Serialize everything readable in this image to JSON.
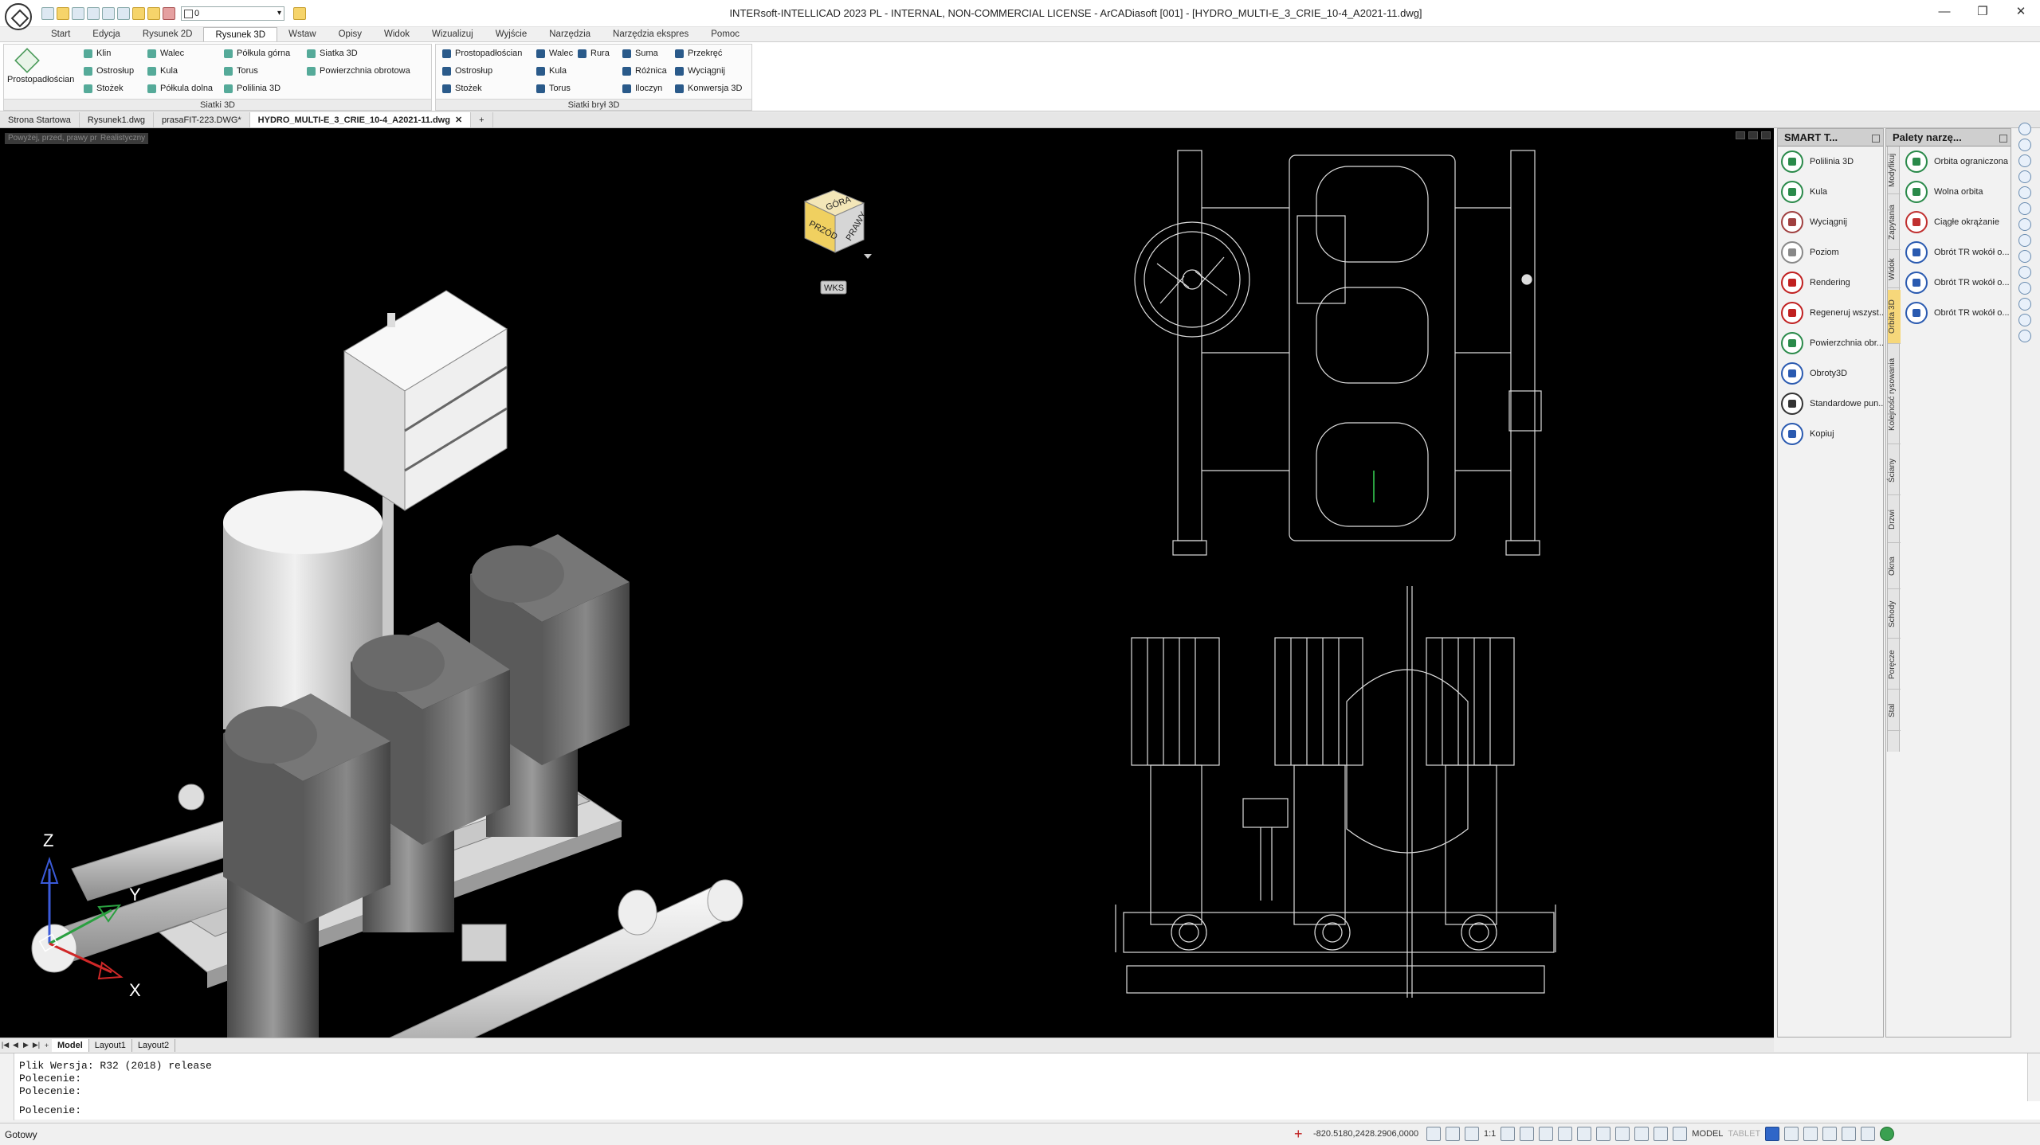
{
  "window": {
    "title": "INTERsoft-INTELLICAD 2023 PL - INTERNAL, NON-COMMERCIAL LICENSE - ArCADiasoft [001] - [HYDRO_MULTI-E_3_CRIE_10-4_A2021-11.dwg]",
    "layer_value": "0"
  },
  "menu": [
    "Start",
    "Edycja",
    "Rysunek 2D",
    "Rysunek 3D",
    "Wstaw",
    "Opisy",
    "Widok",
    "Wizualizuj",
    "Wyjście",
    "Narzędzia",
    "Narzędzia ekspres",
    "Pomoc"
  ],
  "ribbon": {
    "big_button": "Prostopadłościan",
    "panel1_col1": [
      "Klin",
      "Ostrosłup",
      "Stożek"
    ],
    "panel1_col2": [
      "Walec",
      "Kula",
      "Półkula dolna"
    ],
    "panel1_col3": [
      "Półkula górna",
      "Torus",
      "Polilinia 3D"
    ],
    "panel1_col4": [
      "Siatka 3D",
      "Powierzchnia obrotowa"
    ],
    "panel1_title": "Siatki 3D",
    "panel2_col1": [
      "Prostopadłościan",
      "Ostrosłup",
      "Stożek"
    ],
    "panel2_col2": [
      "Walec",
      "Kula",
      "Torus"
    ],
    "panel2_col3": [
      "Rura"
    ],
    "panel2_col4": [
      "Suma",
      "Różnica",
      "Iloczyn"
    ],
    "panel2_col5": [
      "Przekręć",
      "Wyciągnij",
      "Konwersja 3D"
    ],
    "panel2_title": "Siatki brył 3D"
  },
  "file_tabs": [
    "Strona Startowa",
    "Rysunek1.dwg",
    "prasaFIT-223.DWG*",
    "HYDRO_MULTI-E_3_CRIE_10-4_A2021-11.dwg"
  ],
  "viewport": {
    "labels": [
      "Powyżej, przed, prawy przód",
      "Realistyczny"
    ],
    "viewcube": [
      "GÓRA",
      "PRZÓD",
      "PRAWY"
    ],
    "wcs": "WKS",
    "axis_labels": [
      "Z",
      "Y",
      "X"
    ]
  },
  "layout_tabs": [
    "Model",
    "Layout1",
    "Layout2"
  ],
  "command": {
    "history": [
      "Plik Wersja: R32 (2018) release",
      "Polecenie:",
      "Polecenie:"
    ],
    "prompt": "Polecenie:"
  },
  "status": {
    "ready": "Gotowy",
    "coords": "-820.5180,2428.2906,0000",
    "scale": "1:1",
    "model": "MODEL",
    "tablet": "TABLET"
  },
  "smart_palette": {
    "title": "SMART T...",
    "items": [
      "Polilinia 3D",
      "Kula",
      "Wyciągnij",
      "Poziom",
      "Rendering",
      "Regeneruj wszyst...",
      "Powierzchnia obr...",
      "Obroty3D",
      "Standardowe pun...",
      "Kopiuj"
    ]
  },
  "tool_palette": {
    "title": "Palety narzę...",
    "items": [
      "Orbita ograniczona",
      "Wolna orbita",
      "Ciągłe okrążanie",
      "Obrót TR wokół o...",
      "Obrót TR wokół o...",
      "Obrót TR wokół o..."
    ],
    "vtabs": [
      "Modyfikuj",
      "Zapytania",
      "Widok",
      "Orbita 3D",
      "Kolejność rysowania",
      "Ściany",
      "Drzwi",
      "Okna",
      "Schody",
      "Poręcze",
      "Stal"
    ]
  }
}
